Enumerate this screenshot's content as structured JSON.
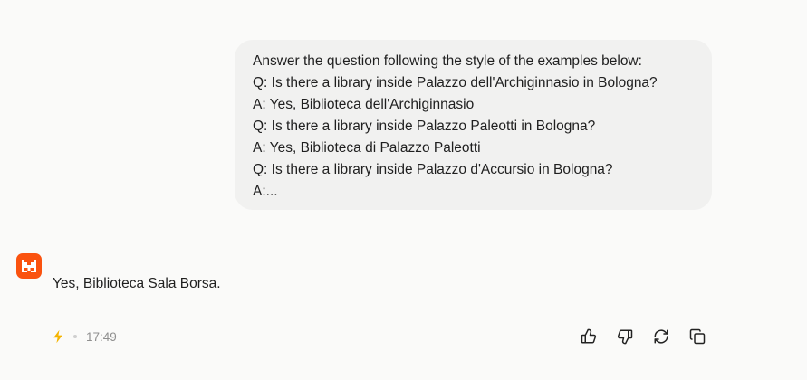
{
  "conversation": {
    "user_message": {
      "lines": [
        "Answer the question following the style of the examples below:",
        "Q: Is there a library inside Palazzo dell'Archiginnasio in Bologna?",
        "A: Yes, Biblioteca dell'Archiginnasio",
        "Q: Is there a library inside Palazzo Paleotti in Bologna?",
        "A: Yes, Biblioteca di Palazzo Paleotti",
        "Q: Is there a library inside Palazzo d'Accursio in Bologna?",
        "A:..."
      ]
    },
    "assistant_message": {
      "avatar_icon": "mistral-logo-icon",
      "text": "Yes, Biblioteca Sala Borsa.",
      "meta": {
        "mode_icon": "flash-icon",
        "time": "17:49"
      },
      "actions": [
        {
          "icon": "thumbs-up-icon"
        },
        {
          "icon": "thumbs-down-icon"
        },
        {
          "icon": "regenerate-icon"
        },
        {
          "icon": "copy-icon"
        }
      ]
    }
  },
  "colors": {
    "background": "#fafaf9",
    "user_bubble": "#f1f1f0",
    "brand_accent": "#fa520f",
    "flash_accent": "#f5b400",
    "muted_text": "#8f8f8f"
  }
}
